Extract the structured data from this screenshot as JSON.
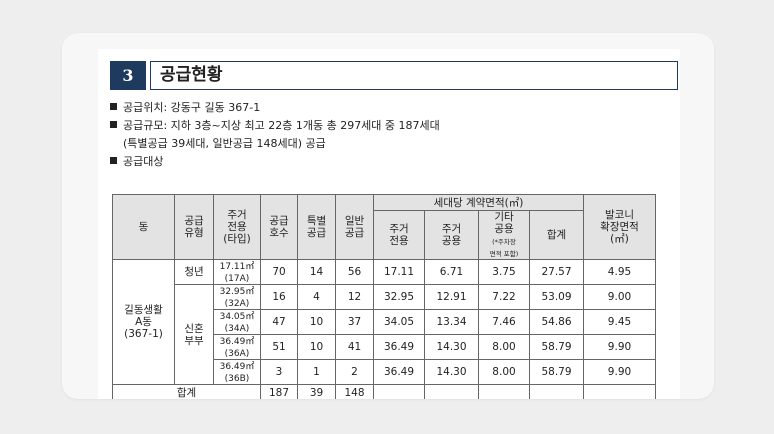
{
  "section": {
    "number": "3",
    "title": "공급현황"
  },
  "bullets": {
    "location": "공급위치: 강동구 길동 367-1",
    "scale_line1": "공급규모: 지하 3층~지상 최고 22층 1개동 총 297세대 중 187세대",
    "scale_line2": "(특별공급 39세대, 일반공급 148세대) 공급",
    "target": "공급대상"
  },
  "table": {
    "headers": {
      "dong": "동",
      "supply_type": [
        "공급",
        "유형"
      ],
      "housing_area": [
        "주거",
        "전용",
        "(타입)"
      ],
      "units": [
        "공급",
        "호수"
      ],
      "special": [
        "특별",
        "공급"
      ],
      "general": [
        "일반",
        "공급"
      ],
      "per_unit_area": "세대당 계약면적(㎡)",
      "private": [
        "주거",
        "전용"
      ],
      "common": [
        "주거",
        "공용"
      ],
      "other_common": [
        "기타",
        "공용"
      ],
      "other_note": [
        "(*주차장",
        "면적 포함)"
      ],
      "total": "합계",
      "balcony": [
        "발코니",
        "확장면적",
        "(㎡)"
      ]
    },
    "dong_name": [
      "길동생활",
      "A동",
      "(367-1)"
    ],
    "type_youth": "청년",
    "type_newlywed": [
      "신혼",
      "부부"
    ],
    "rows": [
      {
        "area": "17.11㎡",
        "type": "(17A)",
        "units": "70",
        "special": "14",
        "general": "56",
        "private": "17.11",
        "common": "6.71",
        "other": "3.75",
        "total": "27.57",
        "balcony": "4.95"
      },
      {
        "area": "32.95㎡",
        "type": "(32A)",
        "units": "16",
        "special": "4",
        "general": "12",
        "private": "32.95",
        "common": "12.91",
        "other": "7.22",
        "total": "53.09",
        "balcony": "9.00"
      },
      {
        "area": "34.05㎡",
        "type": "(34A)",
        "units": "47",
        "special": "10",
        "general": "37",
        "private": "34.05",
        "common": "13.34",
        "other": "7.46",
        "total": "54.86",
        "balcony": "9.45"
      },
      {
        "area": "36.49㎡",
        "type": "(36A)",
        "units": "51",
        "special": "10",
        "general": "41",
        "private": "36.49",
        "common": "14.30",
        "other": "8.00",
        "total": "58.79",
        "balcony": "9.90"
      },
      {
        "area": "36.49㎡",
        "type": "(36B)",
        "units": "3",
        "special": "1",
        "general": "2",
        "private": "36.49",
        "common": "14.30",
        "other": "8.00",
        "total": "58.79",
        "balcony": "9.90"
      }
    ],
    "sum": {
      "label": "합계",
      "units": "187",
      "special": "39",
      "general": "148"
    }
  }
}
